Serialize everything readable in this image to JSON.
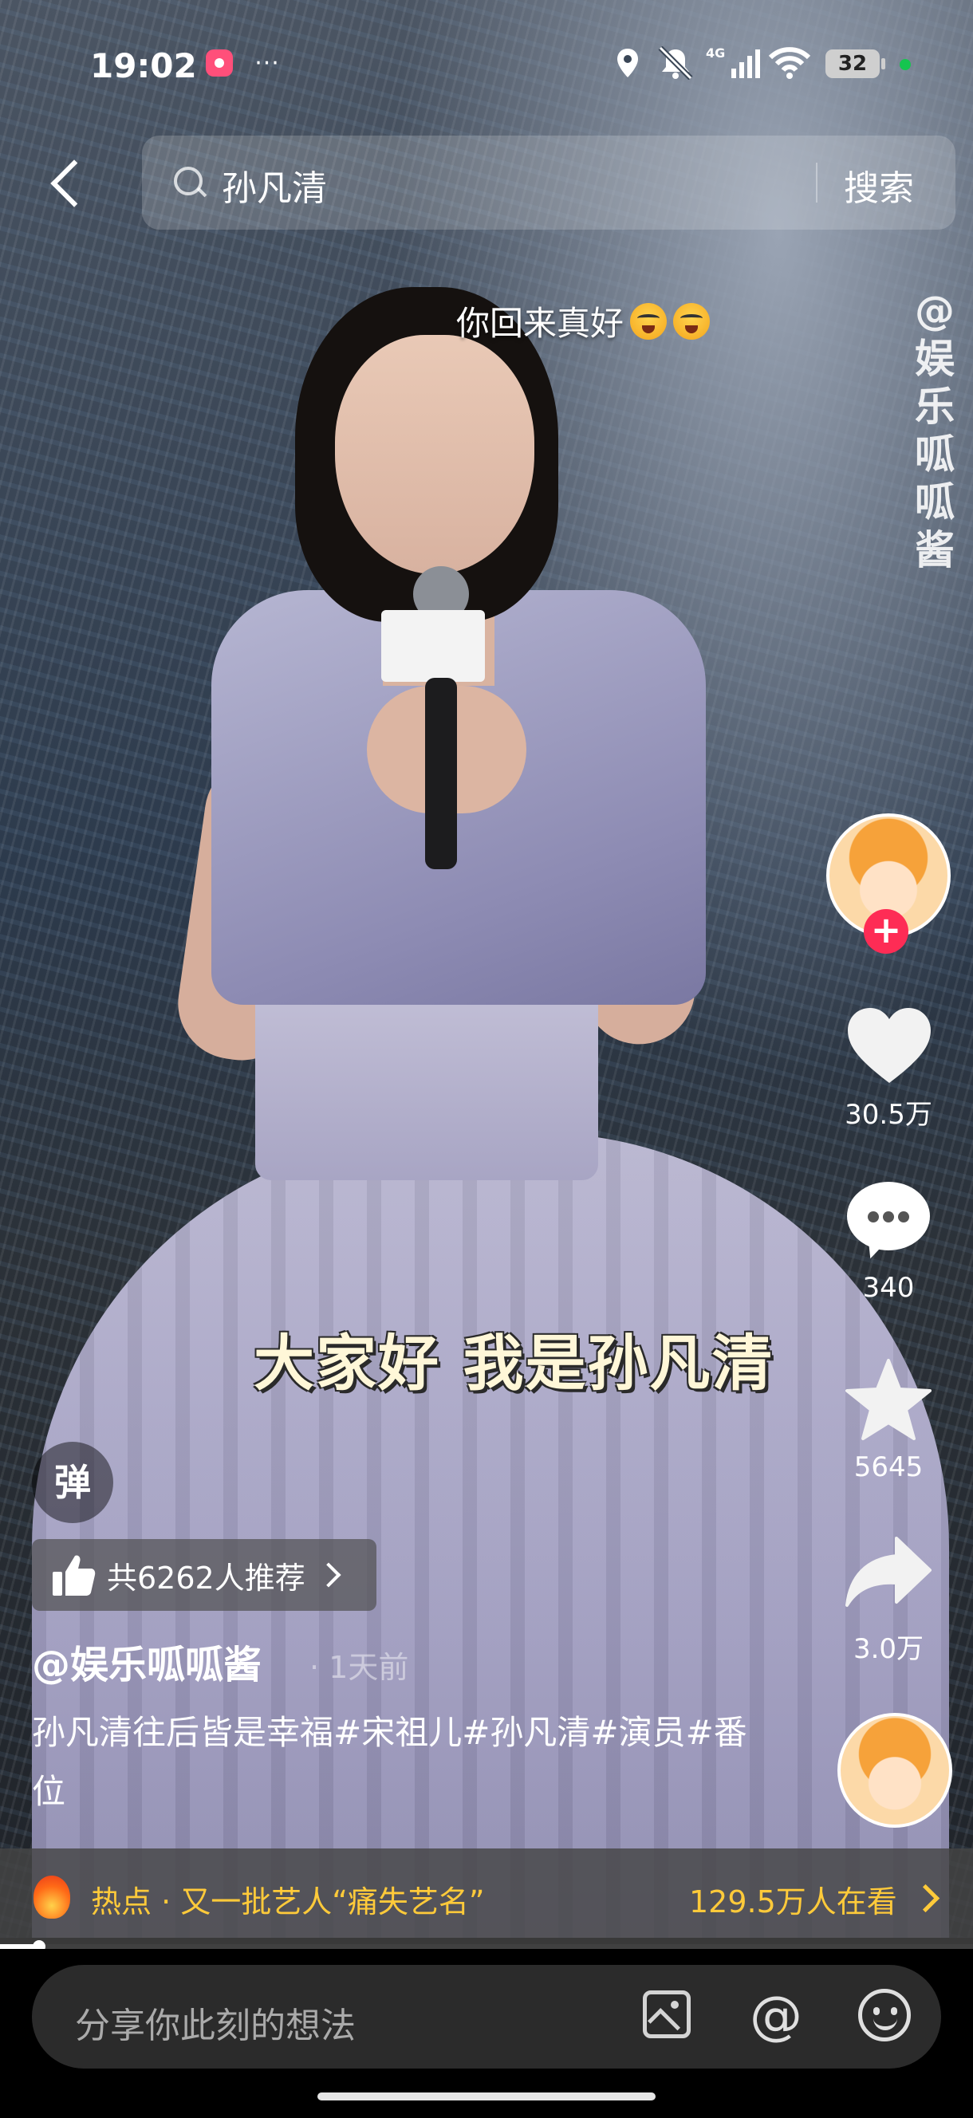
{
  "status_bar": {
    "time": "19:02",
    "signal_label": "4G",
    "battery": "32",
    "icons": [
      "app-notification-icon",
      "more-dots-icon",
      "location-icon",
      "mute-icon",
      "signal-4g-icon",
      "wifi-icon",
      "battery-icon"
    ]
  },
  "search": {
    "query": "孙凡清",
    "button": "搜索",
    "icons": [
      "back-icon",
      "search-icon"
    ]
  },
  "video": {
    "top_caption": "你回来真好",
    "watermark": "@娱乐呱呱酱",
    "subtitle": "大家好 我是孙凡清"
  },
  "actions": {
    "likes": "30.5万",
    "comments": "340",
    "favorites": "5645",
    "shares": "3.0万",
    "icons": [
      "avatar",
      "follow-plus-icon",
      "heart-icon",
      "comment-icon",
      "star-icon",
      "share-icon",
      "music-disc-avatar"
    ]
  },
  "post": {
    "danmu_label": "弹",
    "recommend": "共6262人推荐",
    "author": "@娱乐呱呱酱",
    "time_ago": "· 1天前",
    "description": "孙凡清往后皆是幸福#宋祖儿#孙凡清#演员#番位"
  },
  "hot": {
    "text": "热点 · 又一批艺人“痛失艺名”",
    "viewers": "129.5万人在看"
  },
  "playback": {
    "progress_fraction": 0.04
  },
  "comment_input": {
    "placeholder": "分享你此刻的想法",
    "icons": [
      "image-icon",
      "at-icon",
      "emoji-icon"
    ]
  },
  "colors": {
    "accent_red": "#fe2c55",
    "hot_yellow": "#ffca3a"
  }
}
